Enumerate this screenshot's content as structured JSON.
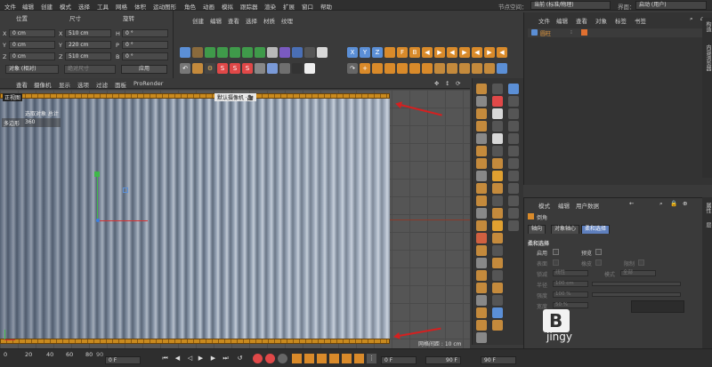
{
  "menubar": {
    "items": [
      "文件",
      "编辑",
      "创建",
      "模式",
      "选择",
      "工具",
      "网格",
      "体积",
      "运动图形",
      "角色",
      "动画",
      "模拟",
      "跟踪器",
      "渲染",
      "扩展",
      "窗口",
      "帮助"
    ],
    "node_space_label": "节点空间：",
    "node_space_value": "当前 (标准/物理)",
    "interface_label": "界面：",
    "interface_value": "启动 (用户)"
  },
  "coord": {
    "headers": [
      "位置",
      "尺寸",
      "旋转"
    ],
    "rows": [
      {
        "axis": "X",
        "pos": "0 cm",
        "size_axis": "X",
        "size": "510 cm",
        "rot_axis": "H",
        "rot": "0 °"
      },
      {
        "axis": "Y",
        "pos": "0 cm",
        "size_axis": "Y",
        "size": "220 cm",
        "rot_axis": "P",
        "rot": "0 °"
      },
      {
        "axis": "Z",
        "pos": "0 cm",
        "size_axis": "Z",
        "size": "510 cm",
        "rot_axis": "B",
        "rot": "0 °"
      }
    ],
    "mode_select": "对象 (相对)",
    "size_select": "绝对尺寸",
    "apply_label": "应用"
  },
  "mid_menu": [
    "创建",
    "编辑",
    "查看",
    "选择",
    "材质",
    "纹理"
  ],
  "viewport": {
    "menu": [
      "查看",
      "摄像机",
      "显示",
      "选项",
      "过滤",
      "面板",
      "ProRender"
    ],
    "view_name": "正视图",
    "camera_label": "默认摄像机 ·🎥",
    "hud_label": "选取对象 总计",
    "hud_row_label": "多边形",
    "hud_row_value": "360",
    "grid_spacing": "网格间距 : 10 cm"
  },
  "objmgr": {
    "menu": [
      "文件",
      "编辑",
      "查看",
      "对象",
      "标签",
      "书签"
    ],
    "object_name": "圆柱"
  },
  "attrmgr": {
    "menu": [
      "模式",
      "编辑",
      "用户数据"
    ],
    "object_title": "倒角",
    "tabs": [
      "轴向",
      "对象轴心",
      "柔和选择"
    ],
    "section_title": "柔和选择",
    "enable_label": "启用",
    "preview_label": "预览",
    "surface_label": "表面",
    "rubber_label": "橡皮",
    "restrict_label": "限制",
    "mode_label": "锁减",
    "mode_value": "线性",
    "mode2_label": "模式",
    "mode2_value": "全部",
    "radius_label": "半径",
    "radius_value": "100 cm",
    "strength_label": "强度",
    "strength_value": "100 %",
    "width_label": "宽度",
    "width_value": "50 %",
    "side_tabs": [
      "属性",
      "层",
      "构造",
      "内容浏览器"
    ]
  },
  "timeline": {
    "ticks": [
      "0",
      "20",
      "40",
      "60",
      "80"
    ],
    "frame_start": "0 F",
    "frame_current": "0 F",
    "frame_end": "90 F",
    "frame_end2": "90 F",
    "marker": "90"
  },
  "watermark": {
    "logo_letter": "B",
    "text": "jingy"
  },
  "colors": {
    "accent_blue": "#5e7fbd",
    "orange_edge": "#c98a1e",
    "arrow_red": "#d42020"
  }
}
